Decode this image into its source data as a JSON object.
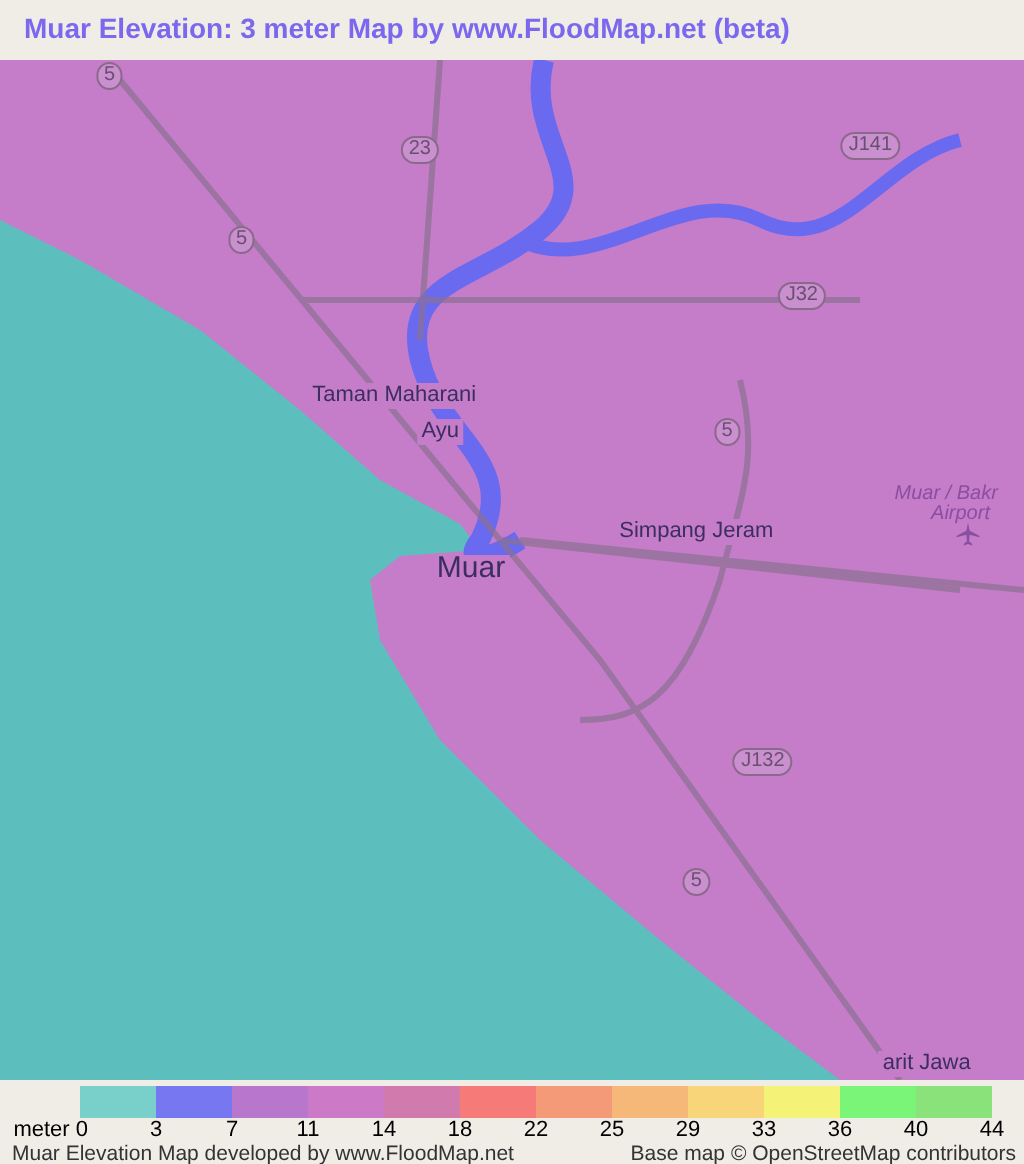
{
  "title": "Muar Elevation: 3 meter Map by www.FloodMap.net (beta)",
  "map": {
    "labels": [
      {
        "text": "Taman Maharani",
        "kind": "place"
      },
      {
        "text": "Ayu",
        "kind": "place"
      },
      {
        "text": "Muar",
        "kind": "town"
      },
      {
        "text": "Simpang Jeram",
        "kind": "place"
      },
      {
        "text": "Muar / Bakr",
        "kind": "airport"
      },
      {
        "text": "Airport",
        "kind": "airport"
      },
      {
        "text": "arit Jawa",
        "kind": "place"
      }
    ],
    "shields": [
      "5",
      "5",
      "23",
      "J141",
      "J32",
      "5",
      "J132",
      "5"
    ]
  },
  "legend": {
    "swatches": [
      {
        "color": "#79d0cb"
      },
      {
        "color": "#7777f2"
      },
      {
        "color": "#b877cc"
      },
      {
        "color": "#cc7ac8"
      },
      {
        "color": "#d07aae"
      },
      {
        "color": "#f57a78"
      },
      {
        "color": "#f59a78"
      },
      {
        "color": "#f5b878"
      },
      {
        "color": "#f7d578"
      },
      {
        "color": "#f5f278"
      },
      {
        "color": "#7af578"
      },
      {
        "color": "#8ae27a"
      }
    ],
    "start": "meter 0",
    "ticks": [
      "3",
      "7",
      "11",
      "14",
      "18",
      "22",
      "25",
      "29",
      "33",
      "36",
      "40",
      "44"
    ]
  },
  "footer": {
    "credit": "Muar Elevation Map developed by www.FloodMap.net",
    "attribution": "Base map © OpenStreetMap contributors"
  }
}
